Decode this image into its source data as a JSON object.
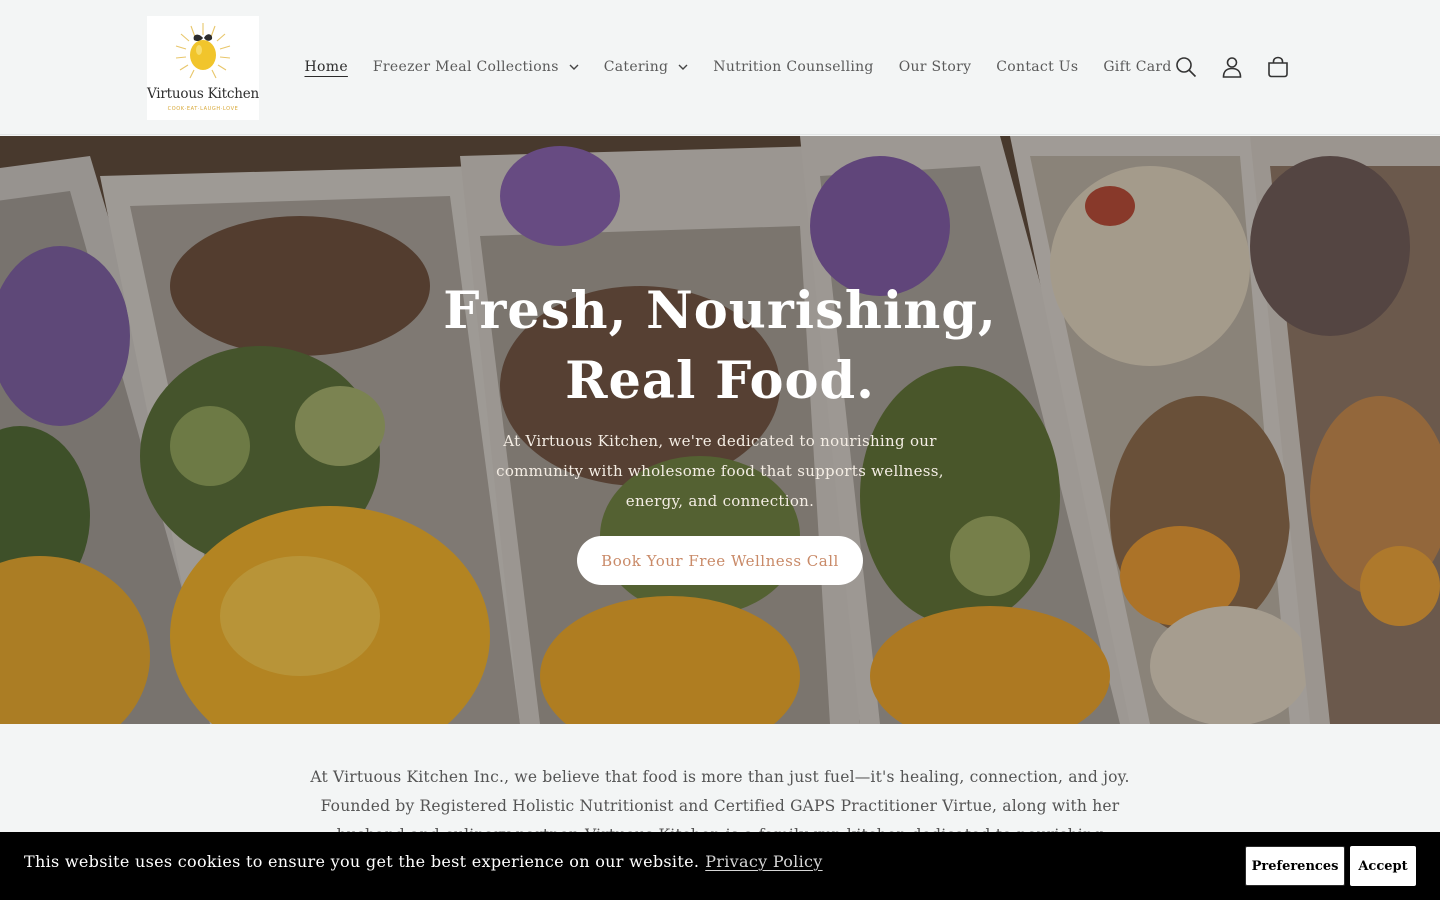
{
  "brand": {
    "name": "Virtuous Kitchen",
    "tagline": "COOK·EAT·LAUGH·LOVE",
    "accent": "#d8a93a"
  },
  "nav": {
    "items": [
      {
        "label": "Home",
        "active": true,
        "dropdown": false
      },
      {
        "label": "Freezer Meal Collections",
        "active": false,
        "dropdown": true
      },
      {
        "label": "Catering",
        "active": false,
        "dropdown": true
      },
      {
        "label": "Nutrition Counselling",
        "active": false,
        "dropdown": false
      },
      {
        "label": "Our Story",
        "active": false,
        "dropdown": false
      },
      {
        "label": "Contact Us",
        "active": false,
        "dropdown": false
      },
      {
        "label": "Gift Card",
        "active": false,
        "dropdown": false
      }
    ],
    "icons": [
      "search-icon",
      "account-icon",
      "cart-icon"
    ]
  },
  "hero": {
    "title_line1": "Fresh, Nourishing,",
    "title_line2": "Real Food.",
    "text": "At Virtuous Kitchen, we're dedicated to nourishing our community with wholesome food that supports wellness, energy, and connection.",
    "cta": "Book Your Free Wellness Call",
    "cta_color": "#c98a68"
  },
  "intro": {
    "text": "At Virtuous Kitchen Inc., we believe that food is more than just fuel—it's healing, connection, and joy. Founded by Registered Holistic Nutritionist and Certified GAPS Practitioner Virtue, along with her husband and culinary partner, Virtuous Kitchen is a family-run kitchen dedicated to nourishing individuals and families"
  },
  "cookie": {
    "text": "This website uses cookies to ensure you get the best experience on our website.",
    "link": "Privacy Policy",
    "preferences": "Preferences",
    "accept": "Accept"
  }
}
